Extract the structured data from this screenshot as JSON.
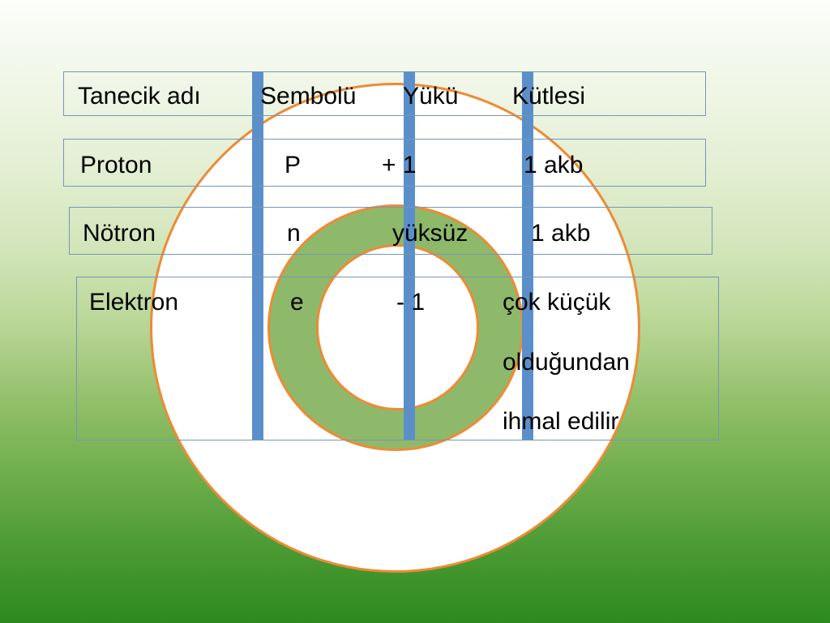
{
  "slide": {
    "background": {
      "top_color": "#fdfefc",
      "bottom_color": "#2d8a1f"
    }
  },
  "diagram": {
    "name": "atom-orbit-diagram",
    "orbit_stroke_color": "#ED8B35",
    "orbits": [
      {
        "name": "outer-orbit",
        "fill": "#ffffff"
      },
      {
        "name": "middle-orbit",
        "fill": "#8FB96A"
      },
      {
        "name": "inner-orbit",
        "fill": "#ffffff"
      }
    ]
  },
  "separators": {
    "color": "#5B8FC9",
    "count": 3
  },
  "table": {
    "border_color": "#7596B8",
    "headers": {
      "name": "Tanecik adı",
      "symbol": "Sembolü",
      "charge": "Yükü",
      "mass": "Kütlesi"
    },
    "rows": [
      {
        "name": "Proton",
        "symbol": "P",
        "charge": "+ 1",
        "mass": "1 akb"
      },
      {
        "name": "Nötron",
        "symbol": "n",
        "charge": "yüksüz",
        "mass": "1 akb"
      },
      {
        "name": "Elektron",
        "symbol": "e",
        "charge": "- 1",
        "mass_line_1": "çok küçük",
        "mass_line_2": "olduğundan",
        "mass_line_3": "ihmal edilir"
      }
    ]
  }
}
